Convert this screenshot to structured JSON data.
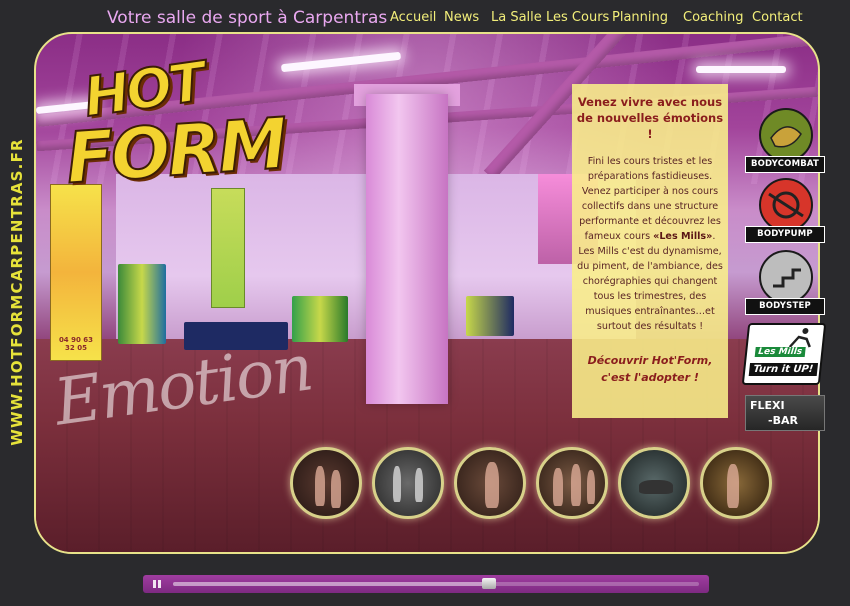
{
  "header": {
    "site_title": "Votre salle de sport à Carpentras",
    "nav": [
      {
        "label": "Accueil"
      },
      {
        "label": "News"
      },
      {
        "label": "La Salle"
      },
      {
        "label": "Les Cours"
      },
      {
        "label": "Planning"
      },
      {
        "label": "Coaching"
      },
      {
        "label": "Contact"
      }
    ]
  },
  "side_url": "WWW.HOTFORMCARPENTRAS.FR",
  "logo": {
    "line1": "HOT",
    "line2": "FORM"
  },
  "hero": {
    "watermark": "Emotion",
    "banner_phone": "04 90 63 32 05"
  },
  "panel": {
    "heading": "Venez vivre avec nous de nouvelles émotions !",
    "body_1": "Fini les cours tristes et les préparations fastidieuses. Venez participer à nos cours collectifs dans une structure performante et découvrez les fameux cours ",
    "body_strong": "«Les Mills»",
    "body_2": ". Les Mills c'est du dynamisme, du piment, de l'ambiance, des chorégraphies qui changent tous les trimestres, des musiques entraînantes…et surtout des résultats !",
    "footer": "Découvrir Hot'Form, c'est l'adopter !"
  },
  "programs": [
    {
      "label": "BODYCOMBAT",
      "color": "#6f8a26"
    },
    {
      "label": "BODYPUMP",
      "color": "#d7352a"
    },
    {
      "label": "BODYSTEP",
      "color": "#b9b9b9"
    }
  ],
  "lesmills": {
    "line1": "Les Mills",
    "line2": "Turn it UP!"
  },
  "flexibar": {
    "line1": "FLEXI",
    "line2": "-BAR"
  },
  "thumbnails": [
    {
      "id": "thumb-1"
    },
    {
      "id": "thumb-2"
    },
    {
      "id": "thumb-3"
    },
    {
      "id": "thumb-4"
    },
    {
      "id": "thumb-5"
    },
    {
      "id": "thumb-6"
    }
  ],
  "player": {
    "progress": 0.6
  },
  "colors": {
    "accent_yellow": "#f2ee7a",
    "title_pink": "#e9a8f0",
    "frame_border": "#e8e28a"
  }
}
